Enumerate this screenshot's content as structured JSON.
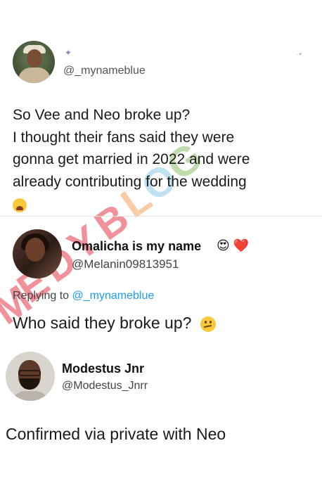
{
  "tweet": {
    "avatar_icon": "profile-photo-icon",
    "small_emoji": "sparkle-emoji-icon",
    "handle": "@_mynameblue",
    "more_icon": "more-dots-icon",
    "lines": [
      "So Vee and Neo broke up?",
      "I thought their fans said they were",
      "gonna get married in 2022 and were",
      "already contributing for the wedding"
    ],
    "emoji": "weary-face-emoji-icon"
  },
  "reply1": {
    "avatar_icon": "profile-photo-icon",
    "display_name": "Omalicha is my name",
    "name_emojis": "😍 ❤️",
    "handle": "@Melanin09813951",
    "replying_prefix": "Replying to",
    "replying_mention": "@_mynameblue",
    "text": "Who said they broke up?",
    "emoji": "thinking-face-emoji-icon"
  },
  "reply2": {
    "avatar_icon": "profile-photo-icon",
    "display_name": "Modestus Jnr",
    "handle": "@Modestus_Jnrr",
    "text": "Confirmed via private with Neo"
  },
  "watermark": {
    "letters": [
      "M",
      "E",
      "D",
      "Y",
      "B",
      "L",
      "O",
      "G"
    ],
    "colors": [
      "#e63946",
      "#e63946",
      "#e63946",
      "#e63946",
      "#e63946",
      "#f4a261",
      "#8ecae6",
      "#90be6d"
    ]
  },
  "colors": {
    "link": "#1d9bf0",
    "text": "#1a1a1a",
    "handle": "#444444"
  }
}
